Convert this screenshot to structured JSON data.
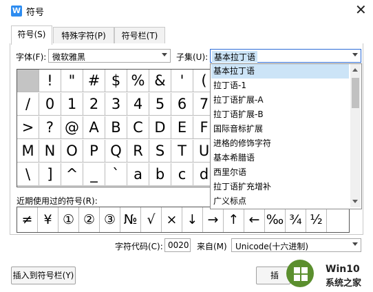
{
  "window": {
    "title": "符号",
    "app_icon_text": "W"
  },
  "tabs": [
    {
      "label": "符号(S)",
      "active": true
    },
    {
      "label": "特殊字符(P)",
      "active": false
    },
    {
      "label": "符号栏(T)",
      "active": false
    }
  ],
  "font": {
    "label": "字体(F):",
    "value": "微软雅黑"
  },
  "subset": {
    "label": "子集(U):",
    "value": "基本拉丁语",
    "options": [
      "基本拉丁语",
      "拉丁语-1",
      "拉丁语扩展-A",
      "拉丁语扩展-B",
      "国际音标扩展",
      "进格的修饰字符",
      "基本希腊语",
      "西里尔语",
      "拉丁语扩充增补",
      "广义标点"
    ]
  },
  "symbol_grid": [
    [
      "",
      "!",
      "\"",
      "#",
      "$",
      "%",
      "&",
      "'",
      "("
    ],
    [
      "/",
      "0",
      "1",
      "2",
      "3",
      "4",
      "5",
      "6",
      "7"
    ],
    [
      ">",
      "?",
      "@",
      "A",
      "B",
      "C",
      "D",
      "E",
      "F"
    ],
    [
      "M",
      "N",
      "O",
      "P",
      "Q",
      "R",
      "S",
      "T",
      "U"
    ],
    [
      "\\",
      "]",
      "^",
      "_",
      "`",
      "a",
      "b",
      "c",
      "d"
    ]
  ],
  "recent": {
    "label": "近期使用过的符号(R):",
    "symbols": [
      "≠",
      "¥",
      "①",
      "②",
      "③",
      "№",
      "√",
      "×",
      "↓",
      "→",
      "↑",
      "←",
      "‰",
      "¾",
      "½",
      ""
    ]
  },
  "char_code": {
    "label": "字符代码(C):",
    "value": "0020"
  },
  "from": {
    "label": "来自(M)",
    "value": "Unicode(十六进制)"
  },
  "buttons": {
    "insert_to_bar": "插入到符号栏(Y)",
    "insert": "插"
  },
  "watermark": {
    "line1": "Win10",
    "line2": "系统之家"
  }
}
